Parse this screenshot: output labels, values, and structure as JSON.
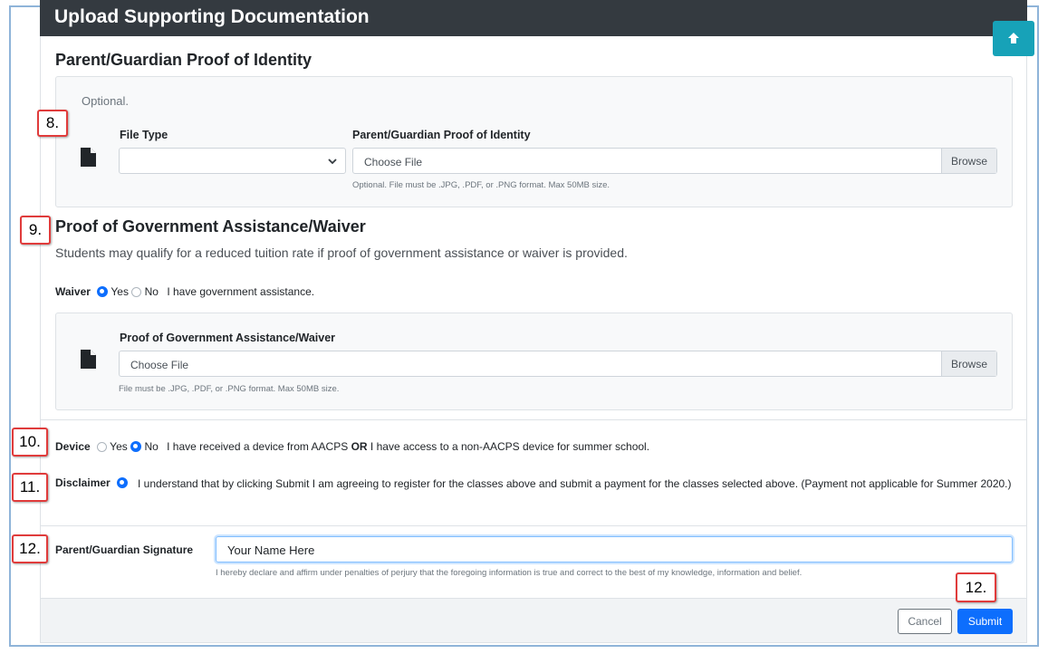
{
  "header": {
    "title": "Upload Supporting Documentation"
  },
  "scroll_top": {
    "icon": "arrow-up-icon"
  },
  "identity": {
    "heading": "Parent/Guardian Proof of Identity",
    "optional_text": "Optional.",
    "file_type_label": "File Type",
    "file_label": "Parent/Guardian Proof of Identity",
    "file_value": "Choose File",
    "browse_label": "Browse",
    "help": "Optional. File must be .JPG, .PDF, or .PNG format. Max 50MB size."
  },
  "assistance": {
    "heading": "Proof of Government Assistance/Waiver",
    "description": "Students may qualify for a reduced tuition rate if proof of government assistance or waiver is provided.",
    "waiver_label": "Waiver",
    "yes": "Yes",
    "no": "No",
    "waiver_text": "I have government assistance.",
    "file_label": "Proof of Government Assistance/Waiver",
    "file_value": "Choose File",
    "browse_label": "Browse",
    "help": "File must be .JPG, .PDF, or .PNG format. Max 50MB size."
  },
  "device": {
    "label": "Device",
    "yes": "Yes",
    "no": "No",
    "text_before": "I have received a device from AACPS",
    "or": "OR",
    "text_after": "I have access to a non-AACPS device for summer school."
  },
  "disclaimer": {
    "label": "Disclaimer",
    "text": "I understand that by clicking Submit I am agreeing to register for the classes above and submit a payment for the classes selected above. (Payment not applicable for Summer 2020.)"
  },
  "signature": {
    "label": "Parent/Guardian Signature",
    "value": "Your Name Here",
    "help": "I hereby declare and affirm under penalties of perjury that the foregoing information is true and correct to the best of my knowledge, information and belief."
  },
  "buttons": {
    "cancel": "Cancel",
    "submit": "Submit"
  },
  "callouts": {
    "c8": "8.",
    "c9": "9.",
    "c10": "10.",
    "c11": "11.",
    "c12a": "12.",
    "c12b": "12."
  },
  "colors": {
    "header_bg": "#343a40",
    "accent": "#0d6efd",
    "scroll_button": "#17a2b8",
    "callout_border": "#e03b3b"
  }
}
